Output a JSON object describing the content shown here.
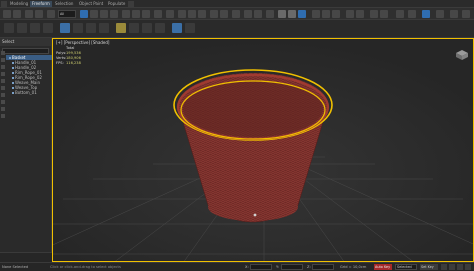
{
  "menu": {
    "tabs": [
      "Modeling",
      "Freeform",
      "Selection",
      "Object Paint",
      "Populate"
    ],
    "active_tab": 1
  },
  "toolbar": {
    "selection_filter": "All"
  },
  "scene_explorer": {
    "title": "Select",
    "items": [
      "Basket",
      "Handle_01",
      "Handle_02",
      "Rim_Rope_01",
      "Rim_Rope_02",
      "Weave_Main",
      "Weave_Top",
      "Bottom_01"
    ],
    "selected_index": 0
  },
  "viewport": {
    "label": "[+] [Perspective] [Shaded]",
    "stats": {
      "header": "Total",
      "rows": [
        {
          "label": "Polys:",
          "value": "199,536"
        },
        {
          "label": "Verts:",
          "value": "180,906"
        },
        {
          "label": "FPS:",
          "value": "116,238"
        }
      ]
    }
  },
  "status": {
    "left": "None Selected",
    "prompt": "Click or click-and-drag to select objects",
    "x_label": "X:",
    "y_label": "Y:",
    "z_label": "Z:",
    "grid": "Grid = 10,0cm",
    "autokey": "Auto Key",
    "selected_mode": "Selected",
    "set_key": "Set Key"
  }
}
